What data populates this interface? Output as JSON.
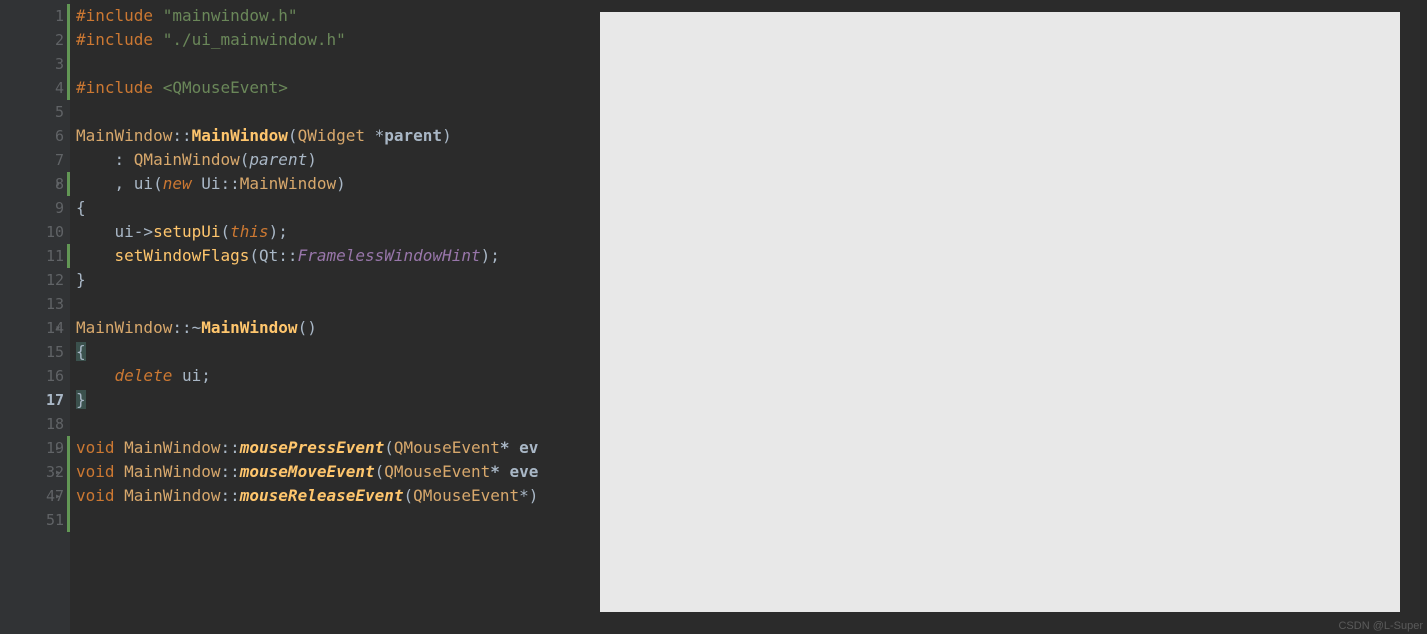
{
  "watermark": "CSDN @L-Super",
  "gutter": [
    {
      "num": "1",
      "changed": true
    },
    {
      "num": "2",
      "changed": true
    },
    {
      "num": "3",
      "changed": true
    },
    {
      "num": "4",
      "changed": true
    },
    {
      "num": "5"
    },
    {
      "num": "6"
    },
    {
      "num": "7"
    },
    {
      "num": "8",
      "fold": "down",
      "changed": true
    },
    {
      "num": "9"
    },
    {
      "num": "10"
    },
    {
      "num": "11",
      "changed": true
    },
    {
      "num": "12"
    },
    {
      "num": "13"
    },
    {
      "num": "14",
      "fold": "down"
    },
    {
      "num": "15"
    },
    {
      "num": "16"
    },
    {
      "num": "17",
      "active": true
    },
    {
      "num": "18"
    },
    {
      "num": "19",
      "fold": "right",
      "changed": true
    },
    {
      "num": "32",
      "fold": "right",
      "changed": true
    },
    {
      "num": "47",
      "fold": "right",
      "changed": true
    },
    {
      "num": "51",
      "changed": true
    }
  ],
  "code": {
    "l1": {
      "preproc": "#include ",
      "str": "\"mainwindow.h\""
    },
    "l2": {
      "preproc": "#include ",
      "str": "\"./ui_mainwindow.h\""
    },
    "l4": {
      "preproc": "#include ",
      "str": "<QMouseEvent>"
    },
    "l6": {
      "cls": "MainWindow",
      "sep": "::",
      "fn": "MainWindow",
      "op": "(",
      "type": "QWidget",
      "star": " *",
      "param": "parent",
      "cp": ")"
    },
    "l7": {
      "indent": "    : ",
      "cls": "QMainWindow",
      "op": "(",
      "param": "parent",
      "cp": ")"
    },
    "l8": {
      "indent": "    , ",
      "ui": "ui",
      "op": "(",
      "kw": "new",
      "ns": " Ui::",
      "cls": "MainWindow",
      "cp": ")"
    },
    "l9": {
      "brace": "{"
    },
    "l10": {
      "indent": "    ",
      "ui": "ui",
      "arrow": "->",
      "fn": "setupUi",
      "op": "(",
      "this": "this",
      "cp": ");"
    },
    "l11": {
      "indent": "    ",
      "fn": "setWindowFlags",
      "op": "(",
      "ns": "Qt::",
      "enum": "FramelessWindowHint",
      "cp": ");"
    },
    "l12": {
      "brace": "}"
    },
    "l14": {
      "cls": "MainWindow",
      "sep": "::~",
      "fn": "MainWindow",
      "parens": "()"
    },
    "l15": {
      "brace": "{"
    },
    "l16": {
      "indent": "    ",
      "kw": "delete",
      "rest": " ui;"
    },
    "l17": {
      "brace": "}"
    },
    "l19": {
      "kw": "void",
      "cls": " MainWindow",
      "sep": "::",
      "fn": "mousePressEvent",
      "op": "(",
      "type": "QMouseEvent",
      "rest": "* ev"
    },
    "l32": {
      "kw": "void",
      "cls": " MainWindow",
      "sep": "::",
      "fn": "mouseMoveEvent",
      "op": "(",
      "type": "QMouseEvent",
      "rest": "* eve"
    },
    "l47": {
      "kw": "void",
      "cls": " MainWindow",
      "sep": "::",
      "fn": "mouseReleaseEvent",
      "op": "(",
      "type": "QMouseEvent",
      "rest": "*)"
    }
  }
}
